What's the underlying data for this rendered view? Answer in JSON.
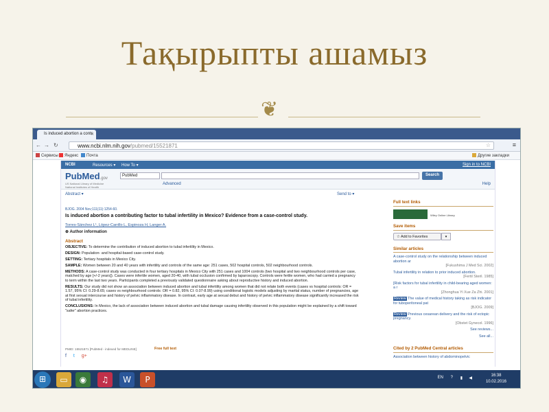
{
  "slide": {
    "title": "Тақырыпты  ашамыз",
    "ornament": "❦"
  },
  "browser": {
    "tab_title": "Is induced abortion a contr",
    "url_host": "www.ncbi.nlm.nih.gov",
    "url_path": "/pubmed/15521871",
    "bookmarks": {
      "services": "Сервисы",
      "yandex": "Яндекс",
      "mail": "Почта",
      "other": "Другие закладки"
    }
  },
  "ncbi": {
    "brand": "NCBI",
    "resources": "Resources ▾",
    "howto": "How To ▾",
    "signin": "Sign in to NCBI"
  },
  "pubmed": {
    "logo": "PubMed",
    "logo_suffix": ".gov",
    "sub1": "US National Library of Medicine",
    "sub2": "National Institutes of Health",
    "db": "PubMed",
    "search": "Search",
    "advanced": "Advanced",
    "help": "Help"
  },
  "article": {
    "format": "Abstract ▾",
    "send_to": "Send to ▾",
    "citation": "BJOG. 2004 Nov;111(11):1254-60.",
    "title": "Is induced abortion a contributing factor to tubal infertility in Mexico? Evidence from a case-control study.",
    "authors": "Torres-Sánchez L¹, López-Carrillo L, Espinoza H, Langer A.",
    "author_info": "⊕ Author information",
    "abstract_head": "Abstract",
    "objective_l": "OBJECTIVE:",
    "objective": "To determine the contribution of induced abortion to tubal infertility in Mexico.",
    "design_l": "DESIGN:",
    "design": "Population- and hospital-based case-control study.",
    "setting_l": "SETTING:",
    "setting": "Tertiary hospitals in Mexico City.",
    "sample_l": "SAMPLE:",
    "sample": "Women between 20 and 40 years with infertility and controls of the same age: 251 cases, 502 hospital controls, 502 neighbourhood controls.",
    "methods_l": "METHODS:",
    "methods": "A case-control study was conducted in four tertiary hospitals in Mexico City with 251 cases and 1004 controls (two hospital and two neighbourhood controls per case, matched by age [+/-2 years]). Cases were infertile women, aged 20-40, with tubal occlusion confirmed by laparoscopy. Controls were fertile women, who had carried a pregnancy to term within the last two years. Participants completed a previously validated questionnaire asking about reproductive history and induced abortion.",
    "results_l": "RESULTS:",
    "results": "Our study did not show an association between induced abortion and tubal infertility among women that did not relate both events (cases vs hospital controls: OR = 1.57, 95% CI: 0.29-8.65; cases vs neighbourhood controls: OR = 0.82, 95% CI: 0.07-8.99) using conditional logistic models adjusting by marital status, number of pregnancies, age at first sexual intercourse and history of pelvic inflammatory disease. In contrast, early age at sexual debut and history of pelvic inflammatory disease significantly increased the risk of tubal infertility.",
    "conclusions_l": "CONCLUSIONS:",
    "conclusions": "In Mexico, the lack of association between induced abortion and tubal damage causing infertility observed in this population might be explained by a shift toward \"safer\" abortion practices.",
    "pmid": "PMID: 15521871 [PubMed - indexed for MEDLINE]",
    "free_full_text": "Free full text"
  },
  "sidebar": {
    "full_text_links": "Full text links",
    "wiley": "Wiley Online Library",
    "save_items": "Save items",
    "add_favorites": "☆ Add to Favorites",
    "similar": "Similar articles",
    "items": [
      {
        "text": "A case-control study on the relationship between induced abortion ar",
        "src": "[Fukushima J Med Sci. 2002]",
        "review": false
      },
      {
        "text": "Tubal infertility in relation to prior induced abortion.",
        "src": "[Fertil Steril. 1985]",
        "review": false
      },
      {
        "text": "[Risk factors for tubal infertility in child-bearing aged women: a r",
        "src": "[Zhonghua Yi Xue Za Zhi. 2001]",
        "review": false
      },
      {
        "text": "The value of medical history taking as risk indicator for tuboperitoneal pat",
        "src": "[BJOG. 2009]",
        "review": true
      },
      {
        "text": "Previous cesarean delivery and the risk of ectopic pregnancy.",
        "src": "[Obstet Gynecol. 1996]",
        "review": true
      }
    ],
    "review_tag": "Review",
    "see_reviews": "See reviews...",
    "see_all": "See all...",
    "cited": "Cited by 2 PubMed Central articles",
    "cited_first": "Association between history of abdominopelvic"
  },
  "taskbar": {
    "lang": "EN",
    "time": "16:38",
    "date": "10.02.2016"
  },
  "colors": {
    "accent": "#8a6a2c",
    "ncbi": "#3a6ea5",
    "section": "#b25a00"
  }
}
